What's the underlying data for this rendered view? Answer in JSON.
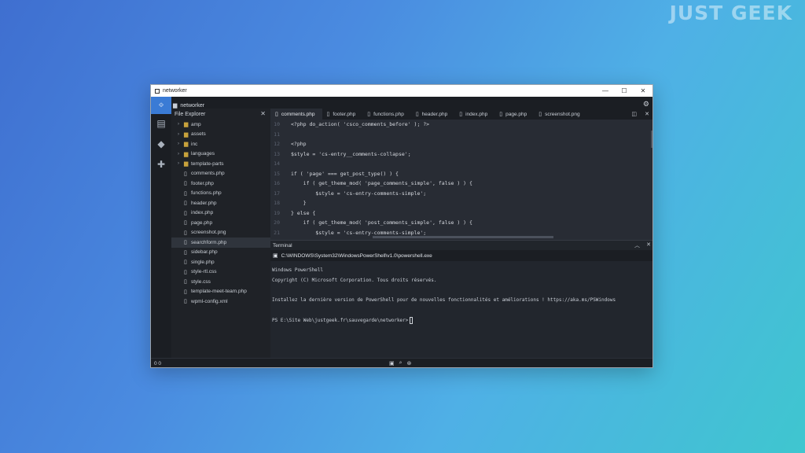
{
  "watermark": "JUST GEEK",
  "window": {
    "title": "networker",
    "controls": {
      "minimize": "—",
      "maximize": "☐",
      "close": "✕"
    }
  },
  "toolbar": {
    "project": "networker",
    "settings_icon": "gear-icon"
  },
  "activity_bar": {
    "icons": [
      "explorer-icon",
      "git-icon",
      "extensions-icon"
    ]
  },
  "explorer": {
    "title": "File Explorer",
    "close": "✕",
    "items": [
      {
        "type": "folder",
        "label": "amp"
      },
      {
        "type": "folder",
        "label": "assets"
      },
      {
        "type": "folder",
        "label": "inc"
      },
      {
        "type": "folder",
        "label": "languages"
      },
      {
        "type": "folder",
        "label": "template-parts"
      },
      {
        "type": "file",
        "label": "comments.php"
      },
      {
        "type": "file",
        "label": "footer.php"
      },
      {
        "type": "file",
        "label": "functions.php"
      },
      {
        "type": "file",
        "label": "header.php"
      },
      {
        "type": "file",
        "label": "index.php"
      },
      {
        "type": "file",
        "label": "page.php"
      },
      {
        "type": "file",
        "label": "screenshot.png"
      },
      {
        "type": "file",
        "label": "searchform.php",
        "selected": true
      },
      {
        "type": "file",
        "label": "sidebar.php"
      },
      {
        "type": "file",
        "label": "single.php"
      },
      {
        "type": "file",
        "label": "style-rtl.css"
      },
      {
        "type": "file",
        "label": "style.css"
      },
      {
        "type": "file",
        "label": "template-meet-team.php"
      },
      {
        "type": "file",
        "label": "wpml-config.xml"
      }
    ]
  },
  "tabs": [
    {
      "label": "comments.php",
      "active": true
    },
    {
      "label": "footer.php"
    },
    {
      "label": "functions.php"
    },
    {
      "label": "header.php"
    },
    {
      "label": "index.php"
    },
    {
      "label": "page.php"
    },
    {
      "label": "screenshot.png"
    }
  ],
  "editor": {
    "lines": [
      {
        "n": "10",
        "text": "<?php do_action( 'csco_comments_before' ); ?>"
      },
      {
        "n": "11",
        "text": ""
      },
      {
        "n": "12",
        "text": "<?php"
      },
      {
        "n": "13",
        "text": "$style = 'cs-entry__comments-collapse';"
      },
      {
        "n": "14",
        "text": ""
      },
      {
        "n": "15",
        "text": "if ( 'page' === get_post_type() ) {"
      },
      {
        "n": "16",
        "text": "    if ( get_theme_mod( 'page_comments_simple', false ) ) {"
      },
      {
        "n": "17",
        "text": "        $style = 'cs-entry-comments-simple';"
      },
      {
        "n": "18",
        "text": "    }"
      },
      {
        "n": "19",
        "text": "} else {"
      },
      {
        "n": "20",
        "text": "    if ( get_theme_mod( 'post_comments_simple', false ) ) {"
      },
      {
        "n": "21",
        "text": "        $style = 'cs-entry-comments-simple';"
      }
    ]
  },
  "terminal": {
    "panel_title": "Terminal",
    "tab_label": "C:\\WINDOWS\\System32\\WindowsPowerShell\\v1.0\\powershell.exe",
    "lines": [
      "Windows PowerShell",
      "Copyright (C) Microsoft Corporation. Tous droits réservés.",
      "",
      "Installez la dernière version de PowerShell pour de nouvelles fonctionnalités et améliorations ! https://aka.ms/PSWindows",
      "",
      "PS E:\\Site Web\\justgeek.fr\\sauvegarde\\networker>"
    ]
  },
  "statusbar": {
    "left": "0 0"
  }
}
